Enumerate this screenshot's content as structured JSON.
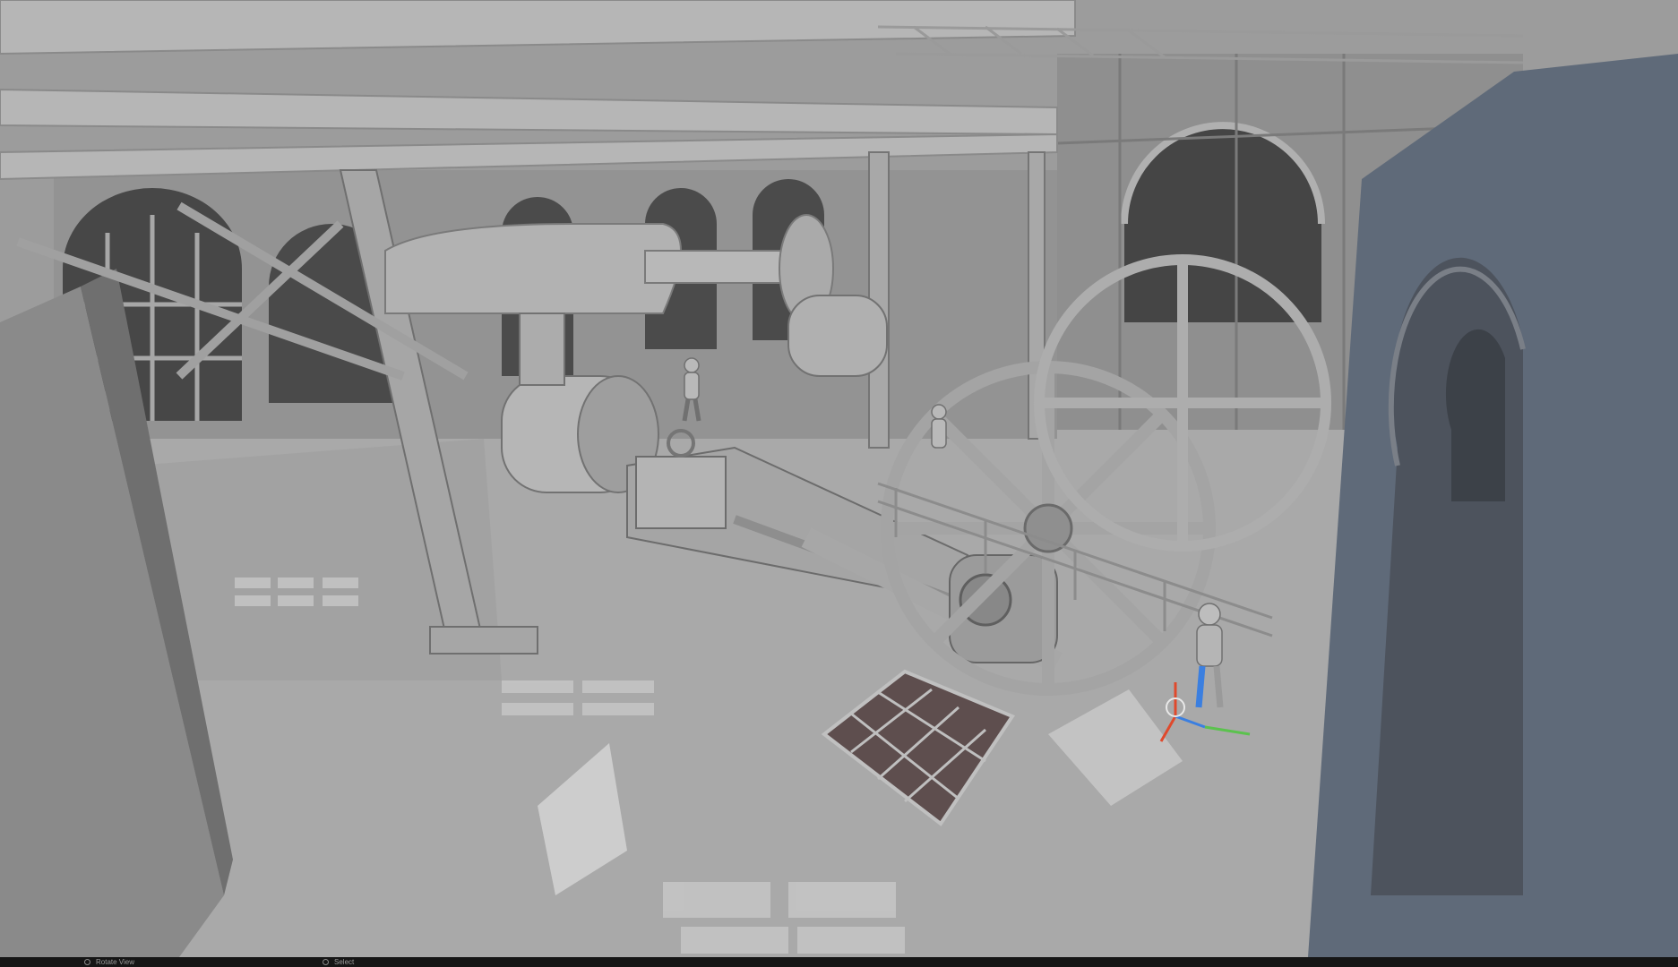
{
  "viewport": {
    "scene": "Steam engine hall (clay render)",
    "gizmo_axes": [
      "x-axis",
      "y-axis",
      "z-axis"
    ],
    "colors": {
      "floor": "#a9a9a9",
      "wall": "#979797",
      "wall_shadow": "#6e6e6e",
      "window": "#424242",
      "metal": "#b3b3b3",
      "metal_dark": "#7c7c7c",
      "blue_wall": "#5f6a79",
      "gizmo_x": "#e0492c",
      "gizmo_y": "#5bc24e",
      "gizmo_z": "#3b7fe0"
    }
  },
  "statusbar": {
    "items": [
      {
        "icon": "mouse-icon",
        "label": "Rotate View"
      },
      {
        "icon": "mouse-icon",
        "label": "Select"
      }
    ]
  }
}
